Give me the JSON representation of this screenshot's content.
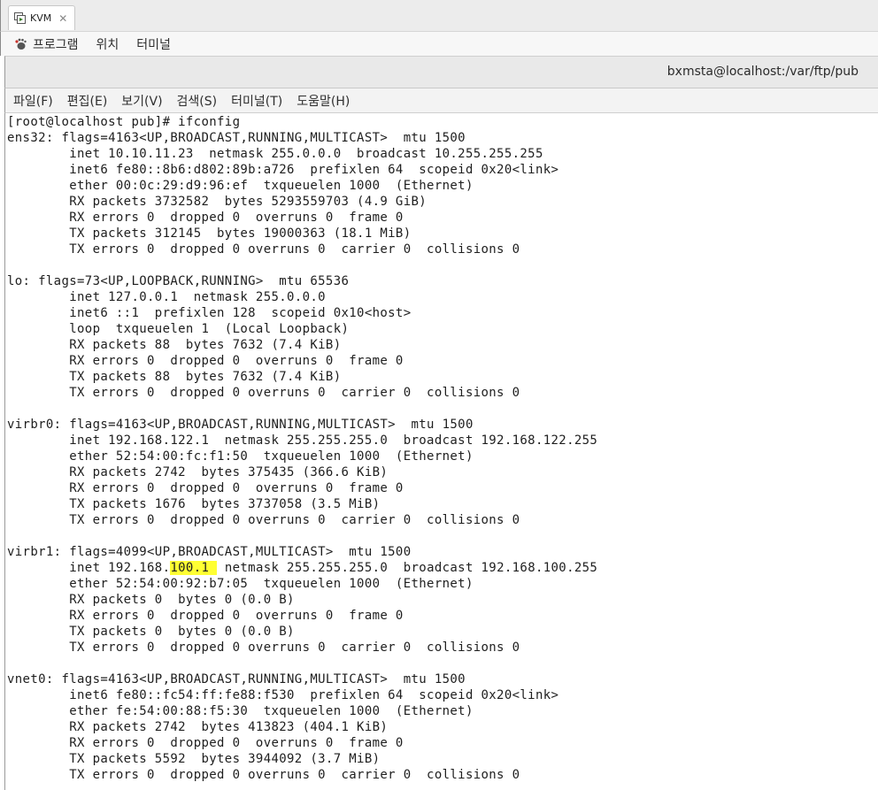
{
  "tab": {
    "label": "KVM",
    "close": "✕"
  },
  "app_menu": {
    "programs": "프로그램",
    "places": "위치",
    "terminal": "터미널"
  },
  "window": {
    "title": "bxmsta@localhost:/var/ftp/pub"
  },
  "menubar": [
    "파일(F)",
    "편집(E)",
    "보기(V)",
    "검색(S)",
    "터미널(T)",
    "도움말(H)"
  ],
  "terminal": {
    "lines": [
      "[root@localhost pub]# ifconfig",
      "ens32: flags=4163<UP,BROADCAST,RUNNING,MULTICAST>  mtu 1500",
      "        inet 10.10.11.23  netmask 255.0.0.0  broadcast 10.255.255.255",
      "        inet6 fe80::8b6:d802:89b:a726  prefixlen 64  scopeid 0x20<link>",
      "        ether 00:0c:29:d9:96:ef  txqueuelen 1000  (Ethernet)",
      "        RX packets 3732582  bytes 5293559703 (4.9 GiB)",
      "        RX errors 0  dropped 0  overruns 0  frame 0",
      "        TX packets 312145  bytes 19000363 (18.1 MiB)",
      "        TX errors 0  dropped 0 overruns 0  carrier 0  collisions 0",
      "",
      "lo: flags=73<UP,LOOPBACK,RUNNING>  mtu 65536",
      "        inet 127.0.0.1  netmask 255.0.0.0",
      "        inet6 ::1  prefixlen 128  scopeid 0x10<host>",
      "        loop  txqueuelen 1  (Local Loopback)",
      "        RX packets 88  bytes 7632 (7.4 KiB)",
      "        RX errors 0  dropped 0  overruns 0  frame 0",
      "        TX packets 88  bytes 7632 (7.4 KiB)",
      "        TX errors 0  dropped 0 overruns 0  carrier 0  collisions 0",
      "",
      "virbr0: flags=4163<UP,BROADCAST,RUNNING,MULTICAST>  mtu 1500",
      "        inet 192.168.122.1  netmask 255.255.255.0  broadcast 192.168.122.255",
      "        ether 52:54:00:fc:f1:50  txqueuelen 1000  (Ethernet)",
      "        RX packets 2742  bytes 375435 (366.6 KiB)",
      "        RX errors 0  dropped 0  overruns 0  frame 0",
      "        TX packets 1676  bytes 3737058 (3.5 MiB)",
      "        TX errors 0  dropped 0 overruns 0  carrier 0  collisions 0",
      "",
      "virbr1: flags=4099<UP,BROADCAST,MULTICAST>  mtu 1500",
      {
        "before": "        inet 192.168.",
        "highlight": "100.1 ",
        "after": " netmask 255.255.255.0  broadcast 192.168.100.255"
      },
      "        ether 52:54:00:92:b7:05  txqueuelen 1000  (Ethernet)",
      "        RX packets 0  bytes 0 (0.0 B)",
      "        RX errors 0  dropped 0  overruns 0  frame 0",
      "        TX packets 0  bytes 0 (0.0 B)",
      "        TX errors 0  dropped 0 overruns 0  carrier 0  collisions 0",
      "",
      "vnet0: flags=4163<UP,BROADCAST,RUNNING,MULTICAST>  mtu 1500",
      "        inet6 fe80::fc54:ff:fe88:f530  prefixlen 64  scopeid 0x20<link>",
      "        ether fe:54:00:88:f5:30  txqueuelen 1000  (Ethernet)",
      "        RX packets 2742  bytes 413823 (404.1 KiB)",
      "        RX errors 0  dropped 0  overruns 0  frame 0",
      "        TX packets 5592  bytes 3944092 (3.7 MiB)",
      "        TX errors 0  dropped 0 overruns 0  carrier 0  collisions 0"
    ]
  }
}
